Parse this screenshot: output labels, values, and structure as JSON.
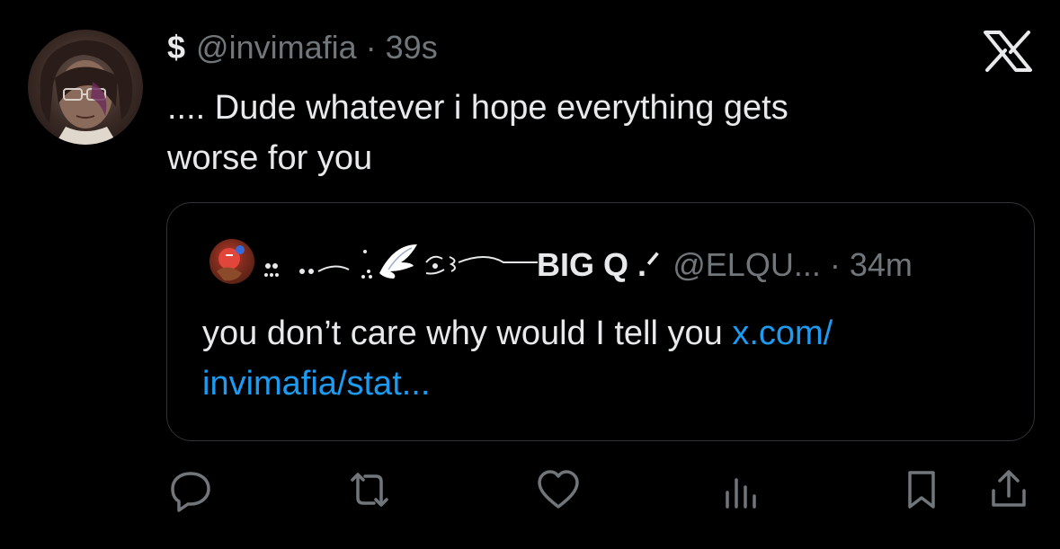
{
  "tweet": {
    "author_display": "$",
    "author_handle": "@invimafia",
    "separator": "·",
    "time": "39s",
    "text_line1": ".... Dude whatever i hope everything gets",
    "text_line2": "worse for you"
  },
  "quoted": {
    "display_name": "BIG Q .ᐟ",
    "handle": "@ELQU...",
    "separator": "·",
    "time": "34m",
    "text_line1_prefix": "you don’t care why would I tell you ",
    "link_part1": "x.com/",
    "link_part2": "invimafia/stat..."
  },
  "icons": {
    "brand": "x-logo-icon",
    "reply": "reply-icon",
    "retweet": "retweet-icon",
    "like": "heart-icon",
    "views": "views-icon",
    "bookmark": "bookmark-icon",
    "share": "share-icon"
  },
  "colors": {
    "background": "#000000",
    "text": "#e7e9ea",
    "muted": "#71767b",
    "link": "#1d9bf0",
    "border": "#2f3336"
  }
}
